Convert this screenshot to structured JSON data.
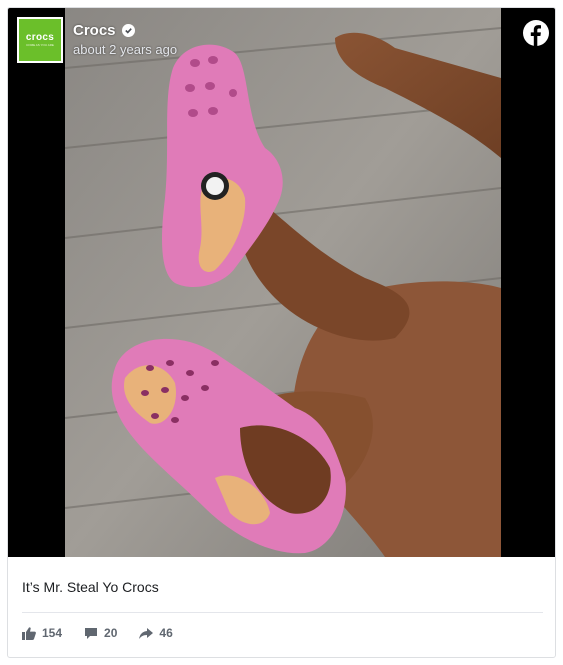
{
  "post": {
    "page_name": "Crocs",
    "timestamp": "about 2 years ago",
    "logo_text": "crocs",
    "logo_subtext": "COME AS YOU ARE",
    "caption": "It’s Mr. Steal Yo Crocs"
  },
  "reactions": {
    "likes": "154",
    "comments": "20",
    "shares": "46"
  },
  "icons": {
    "like": "thumbs-up-icon",
    "comment": "comment-icon",
    "share": "share-icon",
    "platform": "facebook-icon",
    "verified": "verified-badge-icon"
  },
  "colors": {
    "brand_green": "#6bbf2a",
    "clog_pink": "#e07bb8",
    "stat_gray": "#606770"
  }
}
